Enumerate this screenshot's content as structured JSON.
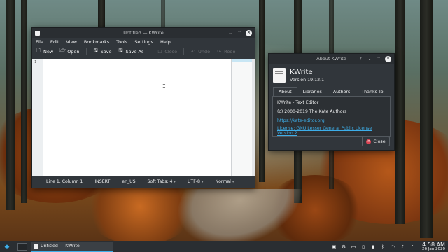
{
  "kwrite": {
    "title": "Untitled — KWrite",
    "menu": [
      "File",
      "Edit",
      "View",
      "Bookmarks",
      "Tools",
      "Settings",
      "Help"
    ],
    "toolbar": {
      "new": "New",
      "open": "Open",
      "save": "Save",
      "save_as": "Save As",
      "close": "Close",
      "undo": "Undo",
      "redo": "Redo"
    },
    "editor": {
      "line_number": "1"
    },
    "status": {
      "position": "Line 1, Column 1",
      "mode": "INSERT",
      "dictionary": "en_US",
      "tabs": "Soft Tabs: 4",
      "encoding": "UTF-8",
      "highlighting": "Normal"
    }
  },
  "about": {
    "title": "About KWrite",
    "app_name": "KWrite",
    "version": "Version 19.12.1",
    "tabs": [
      "About",
      "Libraries",
      "Authors",
      "Thanks To"
    ],
    "active_tab": "About",
    "description": "KWrite - Text Editor",
    "copyright": "(c) 2000-2019 The Kate Authors",
    "website": "https://kate-editor.org",
    "license": "License: GNU Lesser General Public License Version 2",
    "close_label": "Close"
  },
  "taskbar": {
    "task_label": "Untitled — KWrite",
    "time": "4:58 AM",
    "date": "26 Jan 2020"
  },
  "colors": {
    "accent": "#3daee9",
    "window_bg": "#31363b",
    "titlebar_bg": "#2a2e32",
    "close_icon": "#da4453"
  }
}
